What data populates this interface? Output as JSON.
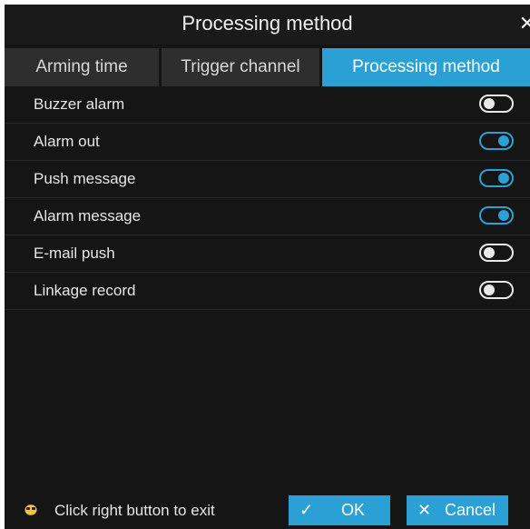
{
  "dialog": {
    "title": "Processing method",
    "close_icon": "close-icon"
  },
  "tabs": [
    {
      "label": "Arming time",
      "active": false
    },
    {
      "label": "Trigger channel",
      "active": false
    },
    {
      "label": "Processing method",
      "active": true
    }
  ],
  "options": [
    {
      "label": "Buzzer alarm",
      "enabled": false
    },
    {
      "label": "Alarm out",
      "enabled": true
    },
    {
      "label": "Push message",
      "enabled": true
    },
    {
      "label": "Alarm message",
      "enabled": true
    },
    {
      "label": "E-mail push",
      "enabled": false
    },
    {
      "label": "Linkage record",
      "enabled": false
    }
  ],
  "footer": {
    "hint_icon": "mouse-icon",
    "hint": "Click right button to exit",
    "ok_label": "OK",
    "ok_icon": "check-icon",
    "cancel_label": "Cancel",
    "cancel_icon": "close-icon"
  },
  "colors": {
    "accent": "#2aa0d4",
    "background": "#151515",
    "tab_inactive": "#2e2e2e"
  }
}
